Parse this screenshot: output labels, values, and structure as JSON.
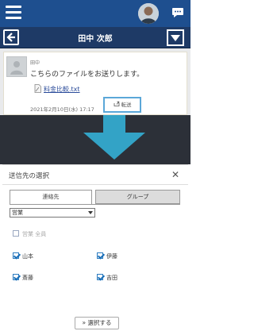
{
  "header": {
    "menu_icon": "hamburger-menu-icon",
    "chat_icon": "chat-bubble-icon",
    "title": "田中 次郎"
  },
  "message": {
    "sender": "田中",
    "text": "こちらのファイルをお送りします。",
    "file_name": "料金比較.txt",
    "timestamp": "2021年2月10日(水) 17:17",
    "reply_label": "転送"
  },
  "modal": {
    "title": "送信先の選択",
    "tabs": [
      "連絡先",
      "グループ"
    ],
    "department": "営業",
    "select_all": "営業 全員",
    "contacts": [
      {
        "name": "山本",
        "checked": true
      },
      {
        "name": "伊藤",
        "checked": true
      },
      {
        "name": "斎藤",
        "checked": true
      },
      {
        "name": "吉田",
        "checked": true
      }
    ],
    "select_button": "» 選択する"
  },
  "colors": {
    "top_bar": "#1e4f8f",
    "title_bar": "#1e3a66",
    "highlight": "#5ba7d8",
    "arrow": "#33a3c6"
  }
}
